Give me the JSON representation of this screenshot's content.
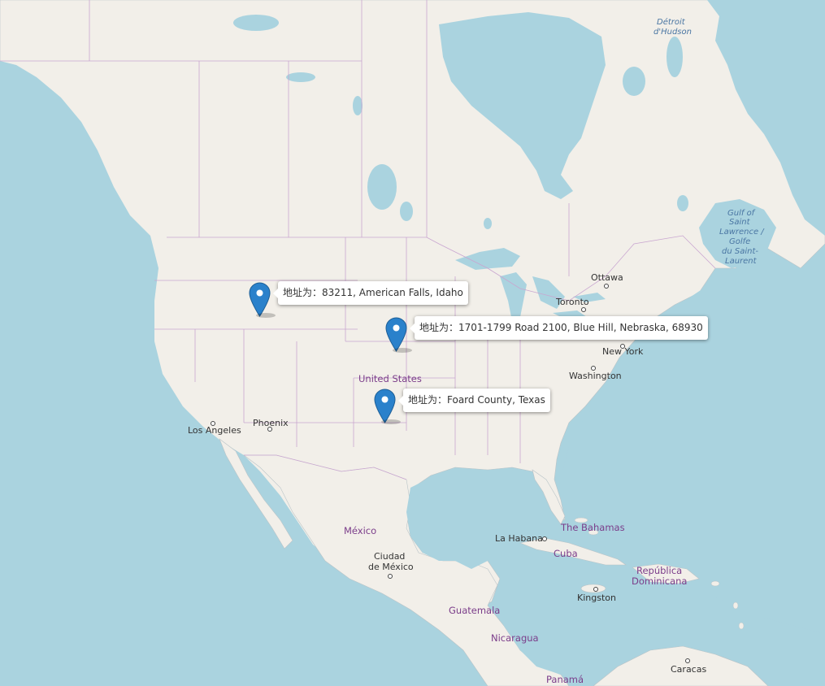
{
  "markers": [
    {
      "tooltip": "地址为：83211, American Falls, Idaho",
      "icon": "map-pin-icon",
      "color": "#2a81cb"
    },
    {
      "tooltip": "地址为：1701-1799 Road 2100, Blue Hill, Nebraska, 68930",
      "icon": "map-pin-icon",
      "color": "#2a81cb"
    },
    {
      "tooltip": "地址为：Foard County, Texas",
      "icon": "map-pin-icon",
      "color": "#2a81cb"
    }
  ],
  "places": {
    "ottawa": "Ottawa",
    "toronto": "Toronto",
    "new_york": "New York",
    "washington": "Washington",
    "los_angeles": "Los Angeles",
    "phoenix": "Phoenix",
    "mexico_city_1": "Ciudad",
    "mexico_city_2": "de México",
    "la_habana": "La Habana",
    "kingston": "Kingston",
    "caracas": "Caracas"
  },
  "countries": {
    "united_states": "United States",
    "mexico": "México",
    "the_bahamas": "The Bahamas",
    "cuba": "Cuba",
    "republica_1": "República",
    "republica_2": "Dominicana",
    "guatemala": "Guatemala",
    "nicaragua": "Nicaragua",
    "panama": "Panamá"
  },
  "water": {
    "hudson_1": "Détroit",
    "hudson_2": "d'Hudson",
    "gulf_1": "Gulf of",
    "gulf_2": "Saint",
    "gulf_3": "Lawrence /",
    "gulf_4": "Golfe",
    "gulf_5": "du Saint-",
    "gulf_6": "Laurent"
  },
  "colors": {
    "land": "#f2efe9",
    "water": "#aad3df",
    "border": "#c9a6d0",
    "marker": "#2a81cb"
  }
}
